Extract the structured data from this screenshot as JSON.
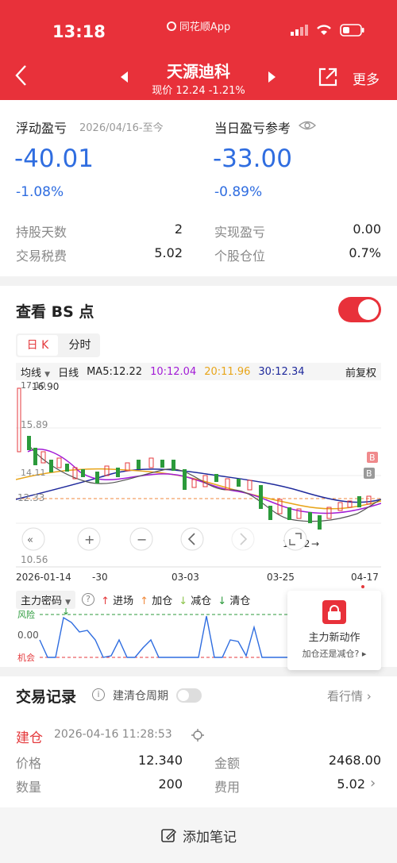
{
  "status": {
    "time": "13:18",
    "app": "同花顺App"
  },
  "nav": {
    "title": "天源迪科",
    "subtitle": "现价 12.24 -1.21%",
    "more": "更多"
  },
  "summary": {
    "float_label": "浮动盈亏",
    "float_date": "2026/04/16-至今",
    "float_value": "-40.01",
    "float_pct": "-1.08%",
    "day_label": "当日盈亏参考",
    "day_value": "-33.00",
    "day_pct": "-0.89%",
    "rows": [
      {
        "l1": "持股天数",
        "v1": "2",
        "l2": "实现盈亏",
        "v2": "0.00"
      },
      {
        "l1": "交易税费",
        "v1": "5.02",
        "l2": "个股仓位",
        "v2": "0.7%"
      }
    ]
  },
  "bs": {
    "title": "查看 BS 点",
    "tabs": [
      "日 K",
      "分时"
    ],
    "ma_bar": {
      "type": "均线",
      "period": "日线",
      "ma5": "MA5:12.22",
      "ma10": "10:12.04",
      "ma20": "20:11.96",
      "ma30": "30:12.34",
      "adj": "前复权"
    },
    "price_labels": {
      "high": "16.90",
      "mid": "15.89",
      "ref": "12.33",
      "low_mark": "11.32",
      "bottom": "10.56",
      "label_14": "14.11",
      "label_17": "17.10"
    },
    "dates": [
      "2026-01-14",
      "-30",
      "03-03",
      "03-25",
      "04-17"
    ],
    "markers": [
      "B",
      "B"
    ],
    "indicator": {
      "name": "主力密码",
      "items": [
        "进场",
        "加仓",
        "减仓",
        "清仓"
      ],
      "risk": "风险",
      "zero": "0.00",
      "chance": "机会"
    },
    "promo": {
      "title": "主力新动作",
      "sub": "加仓还是减仓?"
    }
  },
  "trade": {
    "title": "交易记录",
    "toggle_label": "建清仓周期",
    "link": "看行情",
    "type": "建仓",
    "datetime": "2026-04-16 11:28:53",
    "rows": [
      {
        "l1": "价格",
        "v1": "12.340",
        "l2": "金额",
        "v2": "2468.00"
      },
      {
        "l1": "数量",
        "v1": "200",
        "l2": "费用",
        "v2": "5.02"
      }
    ],
    "note": "添加笔记"
  },
  "chart_data": {
    "type": "candlestick",
    "series_names": [
      "MA5",
      "MA10",
      "MA20",
      "MA30"
    ],
    "ma_values": [
      12.22,
      12.04,
      11.96,
      12.34
    ],
    "ylim": [
      10.56,
      16.9
    ],
    "x_ticks": [
      "2026-01-14",
      "-30",
      "03-03",
      "03-25",
      "04-17"
    ]
  }
}
